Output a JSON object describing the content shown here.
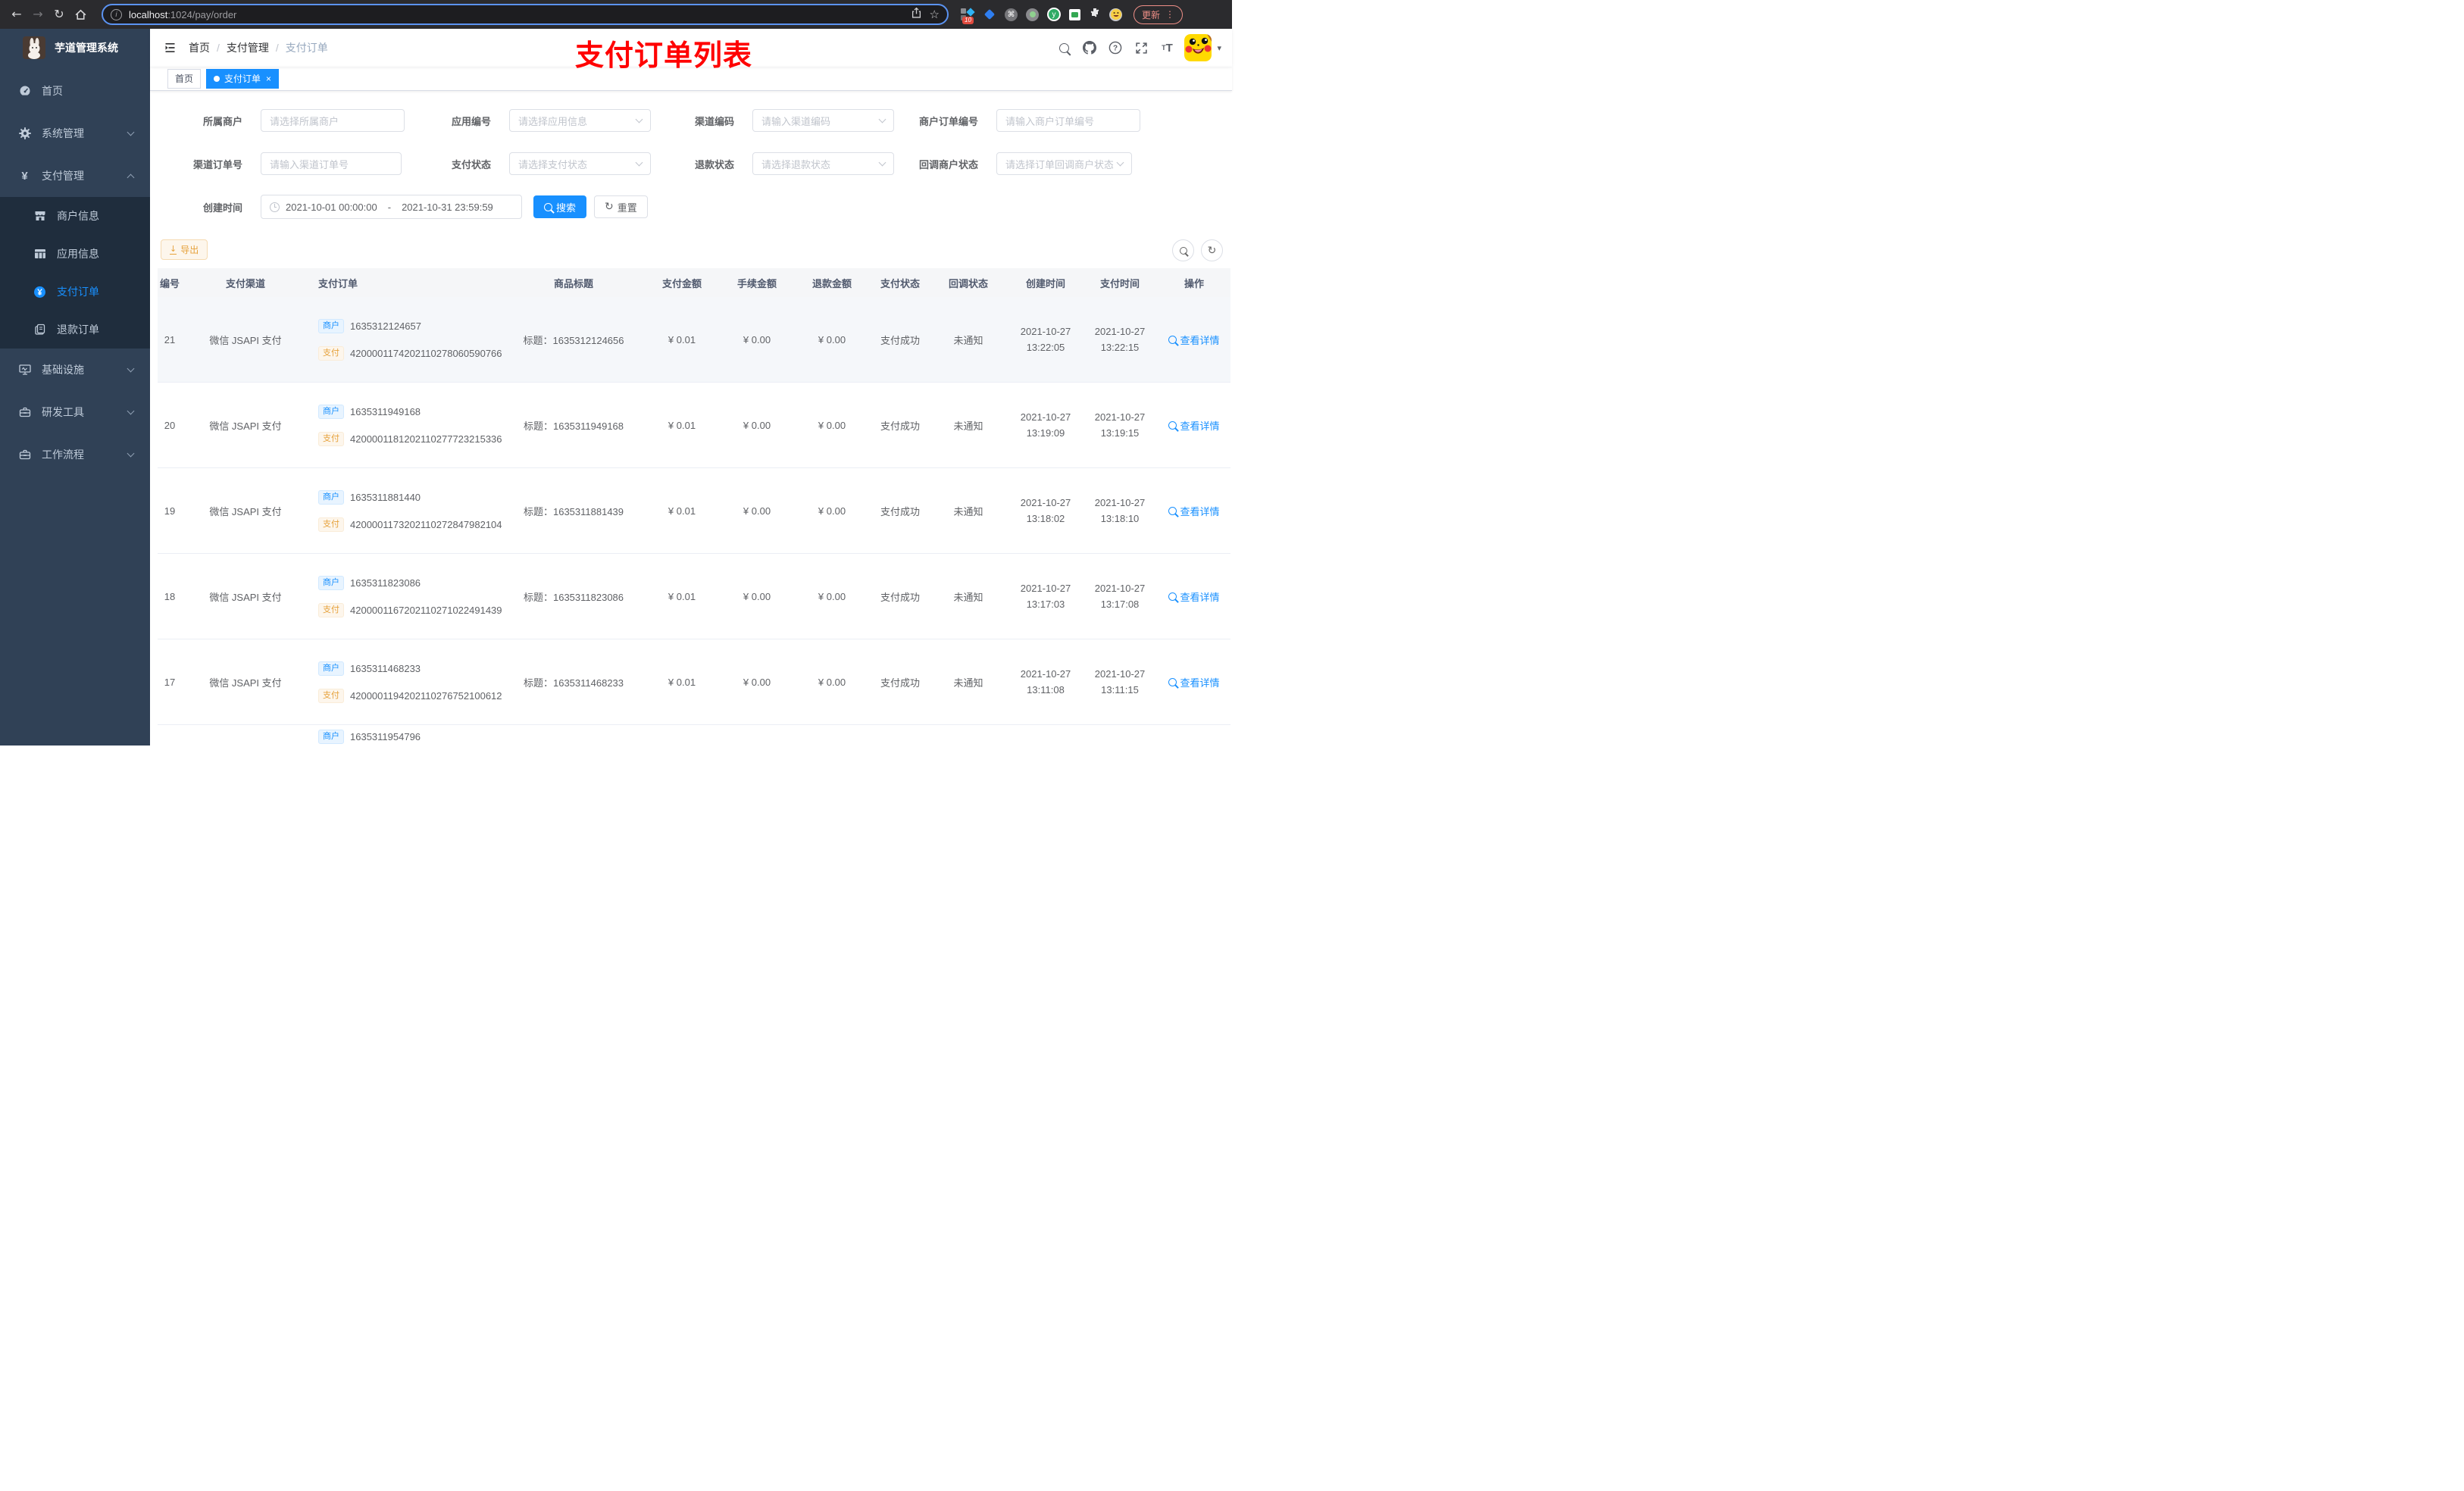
{
  "browser": {
    "url_host": "localhost",
    "url_rest": ":1024/pay/order",
    "ext_badge_count": "10",
    "update_label": "更新"
  },
  "glyphs": {
    "back": "←",
    "forward": "→",
    "reload": "↻",
    "star": "☆",
    "info": "i",
    "cmd": "⌘",
    "kebab": "⋮",
    "caret": "▾",
    "close": "×",
    "slash": "/",
    "question": "?",
    "big_t": "T",
    "small_t": "T",
    "yen": "¥",
    "ext_y": "y",
    "refresh": "↻",
    "download": "↓",
    "dash": "-"
  },
  "sidebar": {
    "title": "芋道管理系统",
    "menu": [
      {
        "label": "首页"
      },
      {
        "label": "系统管理"
      },
      {
        "label": "支付管理"
      },
      {
        "label": "基础设施"
      },
      {
        "label": "研发工具"
      },
      {
        "label": "工作流程"
      }
    ],
    "submenu": [
      {
        "label": "商户信息"
      },
      {
        "label": "应用信息"
      },
      {
        "label": "支付订单"
      },
      {
        "label": "退款订单"
      }
    ]
  },
  "navbar": {
    "breadcrumb": [
      "首页",
      "支付管理",
      "支付订单"
    ],
    "annotation": "支付订单列表"
  },
  "tags": {
    "home": "首页",
    "active": "支付订单"
  },
  "filters": {
    "merchant": {
      "label": "所属商户",
      "placeholder": "请选择所属商户"
    },
    "app": {
      "label": "应用编号",
      "placeholder": "请选择应用信息"
    },
    "channel_code": {
      "label": "渠道编码",
      "placeholder": "请输入渠道编码"
    },
    "merchant_order_no": {
      "label": "商户订单编号",
      "placeholder": "请输入商户订单编号"
    },
    "channel_order_no": {
      "label": "渠道订单号",
      "placeholder": "请输入渠道订单号"
    },
    "pay_status": {
      "label": "支付状态",
      "placeholder": "请选择支付状态"
    },
    "refund_status": {
      "label": "退款状态",
      "placeholder": "请选择退款状态"
    },
    "notify_status": {
      "label": "回调商户状态",
      "placeholder": "请选择订单回调商户状态"
    },
    "create_time": {
      "label": "创建时间",
      "start": "2021-10-01 00:00:00",
      "separator": "-",
      "end": "2021-10-31 23:59:59"
    },
    "search_label": "搜索",
    "reset_label": "重置"
  },
  "toolbar": {
    "export_label": "导出"
  },
  "table": {
    "headers": [
      "编号",
      "支付渠道",
      "支付订单",
      "商品标题",
      "支付金额",
      "手续金额",
      "退款金额",
      "支付状态",
      "回调状态",
      "创建时间",
      "支付时间",
      "操作"
    ],
    "merchant_tag": "商户",
    "pay_tag": "支付",
    "title_prefix": "标题：",
    "action_label": "查看详情",
    "rows": [
      {
        "id": "21",
        "channel": "微信 JSAPI 支付",
        "merchant_no": "1635312124657",
        "pay_no": "4200001174202110278060590766",
        "title": "1635312124656",
        "amount": "¥ 0.01",
        "fee": "¥ 0.00",
        "refund": "¥ 0.00",
        "status": "支付成功",
        "notify": "未通知",
        "create_date": "2021-10-27",
        "create_time": "13:22:05",
        "pay_date": "2021-10-27",
        "pay_time": "13:22:15"
      },
      {
        "id": "20",
        "channel": "微信 JSAPI 支付",
        "merchant_no": "1635311949168",
        "pay_no": "4200001181202110277723215336",
        "title": "1635311949168",
        "amount": "¥ 0.01",
        "fee": "¥ 0.00",
        "refund": "¥ 0.00",
        "status": "支付成功",
        "notify": "未通知",
        "create_date": "2021-10-27",
        "create_time": "13:19:09",
        "pay_date": "2021-10-27",
        "pay_time": "13:19:15"
      },
      {
        "id": "19",
        "channel": "微信 JSAPI 支付",
        "merchant_no": "1635311881440",
        "pay_no": "4200001173202110272847982104",
        "title": "1635311881439",
        "amount": "¥ 0.01",
        "fee": "¥ 0.00",
        "refund": "¥ 0.00",
        "status": "支付成功",
        "notify": "未通知",
        "create_date": "2021-10-27",
        "create_time": "13:18:02",
        "pay_date": "2021-10-27",
        "pay_time": "13:18:10"
      },
      {
        "id": "18",
        "channel": "微信 JSAPI 支付",
        "merchant_no": "1635311823086",
        "pay_no": "4200001167202110271022491439",
        "title": "1635311823086",
        "amount": "¥ 0.01",
        "fee": "¥ 0.00",
        "refund": "¥ 0.00",
        "status": "支付成功",
        "notify": "未通知",
        "create_date": "2021-10-27",
        "create_time": "13:17:03",
        "pay_date": "2021-10-27",
        "pay_time": "13:17:08"
      },
      {
        "id": "17",
        "channel": "微信 JSAPI 支付",
        "merchant_no": "1635311468233",
        "pay_no": "4200001194202110276752100612",
        "title": "1635311468233",
        "amount": "¥ 0.01",
        "fee": "¥ 0.00",
        "refund": "¥ 0.00",
        "status": "支付成功",
        "notify": "未通知",
        "create_date": "2021-10-27",
        "create_time": "13:11:08",
        "pay_date": "2021-10-27",
        "pay_time": "13:11:15"
      }
    ],
    "partial_row": {
      "merchant_no": "1635311954796"
    }
  },
  "colors": {
    "primary": "#1890ff",
    "warning": "#e6a23c",
    "annotation": "#ff0000",
    "sidebar_bg": "#304156",
    "submenu_bg": "#1f2d3d"
  }
}
